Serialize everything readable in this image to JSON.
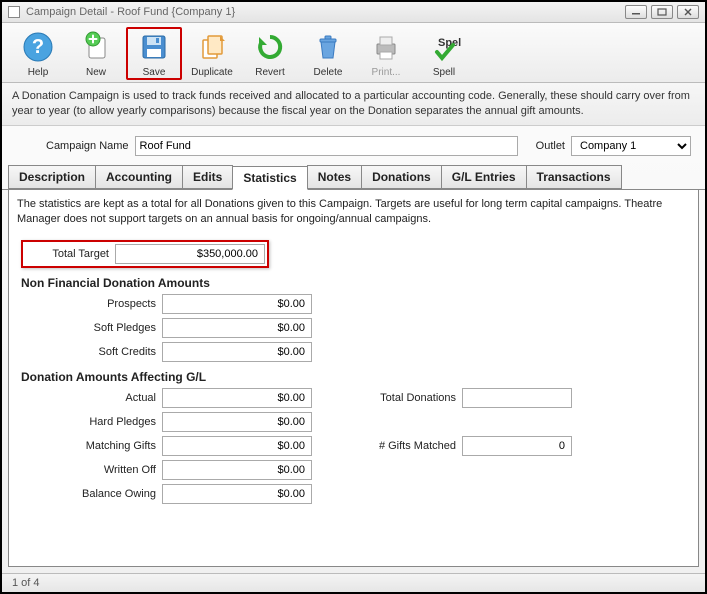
{
  "window": {
    "title": "Campaign Detail - Roof Fund {Company 1}"
  },
  "toolbar": {
    "help": "Help",
    "new": "New",
    "save": "Save",
    "duplicate": "Duplicate",
    "revert": "Revert",
    "delete": "Delete",
    "print": "Print...",
    "spell": "Spell"
  },
  "info_text": "A Donation Campaign is used to track funds received and allocated to a particular accounting code.  Generally, these should carry over from year to year (to allow yearly comparisons) because the fiscal year on the Donation separates the annual gift amounts.",
  "form": {
    "campaign_name_label": "Campaign Name",
    "campaign_name_value": "Roof Fund",
    "outlet_label": "Outlet",
    "outlet_value": "Company 1"
  },
  "tabs": [
    "Description",
    "Accounting",
    "Edits",
    "Statistics",
    "Notes",
    "Donations",
    "G/L Entries",
    "Transactions"
  ],
  "active_tab": "Statistics",
  "stats": {
    "intro": "The statistics are kept as a total for all Donations given to this Campaign.   Targets are useful for long term capital campaigns. Theatre Manager does not support targets on an annual basis for ongoing/annual campaigns.",
    "total_target_label": "Total Target",
    "total_target_value": "$350,000.00",
    "section_nonfin": "Non Financial Donation Amounts",
    "prospects_label": "Prospects",
    "prospects_value": "$0.00",
    "soft_pledges_label": "Soft Pledges",
    "soft_pledges_value": "$0.00",
    "soft_credits_label": "Soft Credits",
    "soft_credits_value": "$0.00",
    "section_gl": "Donation Amounts Affecting G/L",
    "actual_label": "Actual",
    "actual_value": "$0.00",
    "total_donations_label": "Total  Donations",
    "total_donations_value": "",
    "hard_pledges_label": "Hard Pledges",
    "hard_pledges_value": "$0.00",
    "matching_gifts_label": "Matching Gifts",
    "matching_gifts_value": "$0.00",
    "gifts_matched_label": "# Gifts Matched",
    "gifts_matched_value": "0",
    "written_off_label": "Written Off",
    "written_off_value": "$0.00",
    "balance_owing_label": "Balance Owing",
    "balance_owing_value": "$0.00"
  },
  "status": "1 of 4"
}
